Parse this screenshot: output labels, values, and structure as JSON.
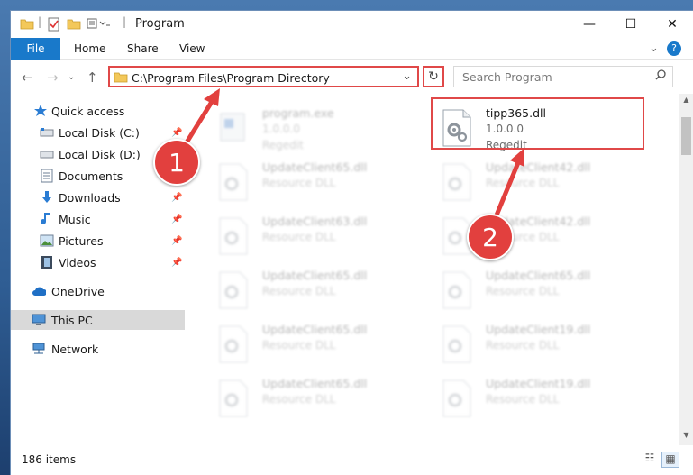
{
  "window": {
    "title": "Program",
    "minimize": "—",
    "maximize": "☐",
    "close": "✕",
    "help": "?"
  },
  "ribbon": {
    "tabs": [
      "File",
      "Home",
      "Share",
      "View"
    ],
    "expand": "⌄"
  },
  "address": {
    "path": "C:\\Program Files\\Program Directory",
    "dropdown": "⌄",
    "refresh": "↻",
    "search_placeholder": "Search Program"
  },
  "nav": {
    "items": [
      {
        "label": "Quick access",
        "icon": "star-icon",
        "pinned": false
      },
      {
        "label": "Local Disk (C:)",
        "icon": "drive-icon",
        "pinned": true
      },
      {
        "label": "Local Disk (D:)",
        "icon": "drive-icon",
        "pinned": true
      },
      {
        "label": "Documents",
        "icon": "documents-icon",
        "pinned": true
      },
      {
        "label": "Downloads",
        "icon": "download-icon",
        "pinned": true
      },
      {
        "label": "Music",
        "icon": "music-icon",
        "pinned": true
      },
      {
        "label": "Pictures",
        "icon": "pictures-icon",
        "pinned": true
      },
      {
        "label": "Videos",
        "icon": "videos-icon",
        "pinned": true
      },
      {
        "label": "OneDrive",
        "icon": "cloud-icon",
        "pinned": false
      },
      {
        "label": "This PC",
        "icon": "computer-icon",
        "pinned": false,
        "selected": true
      },
      {
        "label": "Network",
        "icon": "network-icon",
        "pinned": false
      }
    ]
  },
  "files": [
    {
      "name": "program.exe",
      "version": "1.0.0.0",
      "type": "Regedit",
      "icon": "exe-icon"
    },
    {
      "name": "tipp365.dll",
      "version": "1.0.0.0",
      "type": "Regedit",
      "icon": "dll-gear-icon",
      "highlighted": true
    },
    {
      "name": "UpdateClient65.dll",
      "type": "Resource DLL"
    },
    {
      "name": "UpdateClient42.dll",
      "type": "Resource DLL"
    },
    {
      "name": "UpdateClient63.dll",
      "type": "Resource DLL"
    },
    {
      "name": "UpdateClient42.dll",
      "type": "Resource DLL"
    },
    {
      "name": "UpdateClient65.dll",
      "type": "Resource DLL"
    },
    {
      "name": "UpdateClient65.dll",
      "type": "Resource DLL"
    },
    {
      "name": "UpdateClient65.dll",
      "type": "Resource DLL"
    },
    {
      "name": "UpdateClient19.dll",
      "type": "Resource DLL"
    },
    {
      "name": "UpdateClient65.dll",
      "type": "Resource DLL"
    },
    {
      "name": "UpdateClient19.dll",
      "type": "Resource DLL"
    }
  ],
  "status": {
    "item_count": "186 items"
  },
  "annotations": {
    "step1": "1",
    "step2": "2",
    "accent": "#e04848"
  }
}
